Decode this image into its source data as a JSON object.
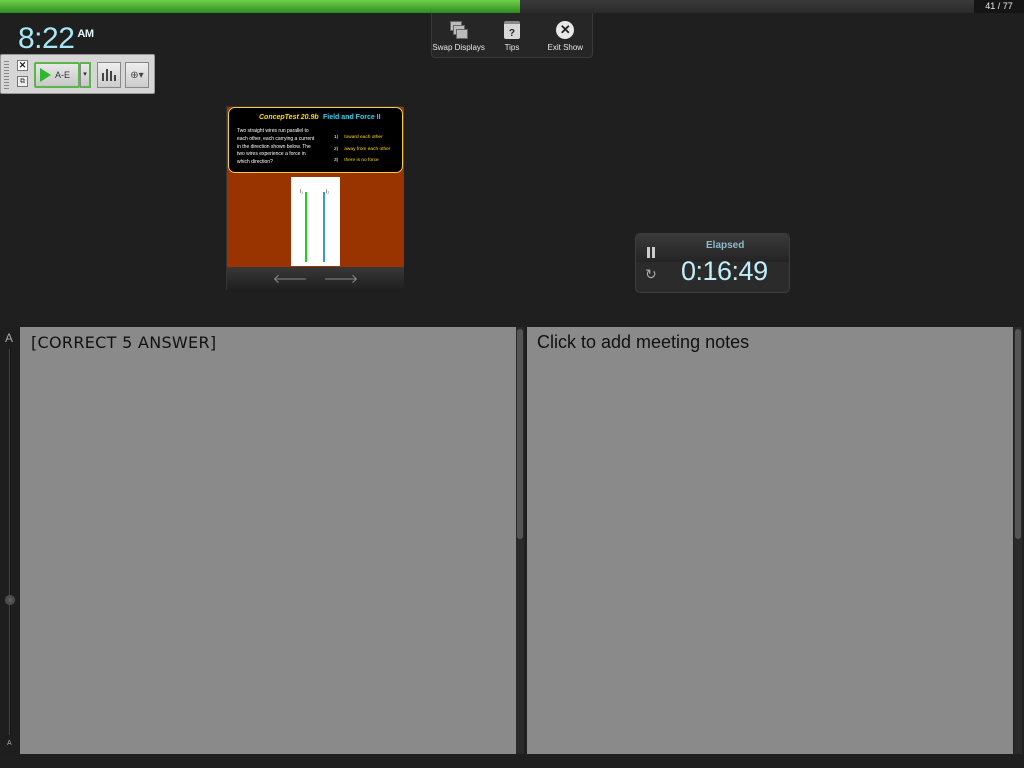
{
  "progress": {
    "slide_counter": "41 / 77",
    "value": 0.5078
  },
  "clock": {
    "time": "8:22",
    "ampm": "AM"
  },
  "top_toolbar": {
    "swap_label": "Swap Displays",
    "tips_label": "Tips",
    "exit_label": "Exit Show"
  },
  "clicker": {
    "start_mode": "A-E",
    "close_glyph": "✕",
    "copy_glyph": "⧉",
    "dropdown_glyph": "▾",
    "globe_glyph": "⊕▾"
  },
  "slide": {
    "title": "ConcepTest 20.9b",
    "subtitle": "Field and Force II",
    "question": "Two straight wires run parallel to each other, each carrying a current in the direction shown below. The two wires experience a force in which direction?",
    "options": [
      {
        "num": "1)",
        "text": "toward each other"
      },
      {
        "num": "2)",
        "text": "away from each other"
      },
      {
        "num": "3)",
        "text": "there is no force"
      }
    ],
    "figure": {
      "label1": "I₁",
      "label2": "I₂"
    },
    "prev_glyph": "🡐",
    "next_glyph": "🡒"
  },
  "timer": {
    "label": "Elapsed",
    "time": "0:16:49",
    "reset_glyph": "↻"
  },
  "font_slider": {
    "large": "A",
    "small": "A",
    "value": 0.65
  },
  "notes": {
    "speaker_text": "[CORRECT 5 ANSWER]",
    "meeting_placeholder": "Click to add meeting notes"
  },
  "colors": {
    "accent_green": "#4caf2a",
    "clock_color": "#a9e6f5",
    "slide_bg": "#993300"
  }
}
